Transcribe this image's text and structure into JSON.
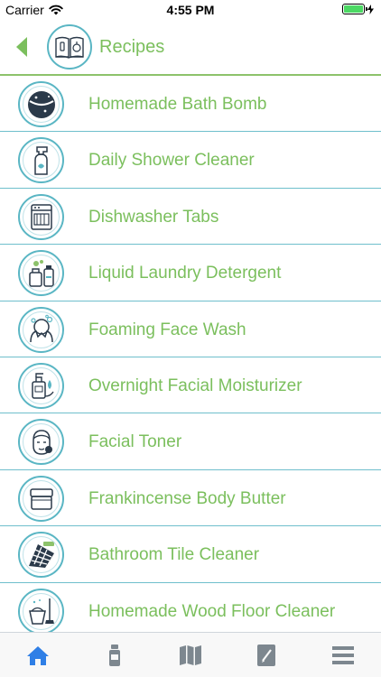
{
  "status_bar": {
    "carrier": "Carrier",
    "time": "4:55 PM",
    "battery_level": 1.0
  },
  "header": {
    "title": "Recipes",
    "back_icon": "chevron-left-icon",
    "icon": "recipe-book-icon"
  },
  "colors": {
    "accent_green": "#7bbf5d",
    "teal": "#5ab6c4",
    "divider": "#6fbfcc",
    "tab_active": "#2f7fe6",
    "tab_inactive": "#7d878f"
  },
  "recipes": [
    {
      "label": "Homemade Bath Bomb",
      "icon": "bath-bomb-icon"
    },
    {
      "label": "Daily Shower Cleaner",
      "icon": "spray-bottle-icon"
    },
    {
      "label": "Dishwasher Tabs",
      "icon": "dishwasher-icon"
    },
    {
      "label": "Liquid Laundry Detergent",
      "icon": "laundry-detergent-icon"
    },
    {
      "label": "Foaming Face Wash",
      "icon": "face-wash-icon"
    },
    {
      "label": "Overnight Facial Moisturizer",
      "icon": "moisturizer-bottle-icon"
    },
    {
      "label": "Facial Toner",
      "icon": "facial-toner-icon"
    },
    {
      "label": "Frankincense Body Butter",
      "icon": "body-butter-jar-icon"
    },
    {
      "label": "Bathroom Tile Cleaner",
      "icon": "tile-cleaner-icon"
    },
    {
      "label": "Homemade Wood Floor Cleaner",
      "icon": "mop-bucket-icon"
    }
  ],
  "tab_bar": {
    "active_index": 0,
    "tabs": [
      {
        "icon": "home-icon"
      },
      {
        "icon": "bottle-icon"
      },
      {
        "icon": "map-icon"
      },
      {
        "icon": "notebook-icon"
      },
      {
        "icon": "menu-icon"
      }
    ]
  }
}
